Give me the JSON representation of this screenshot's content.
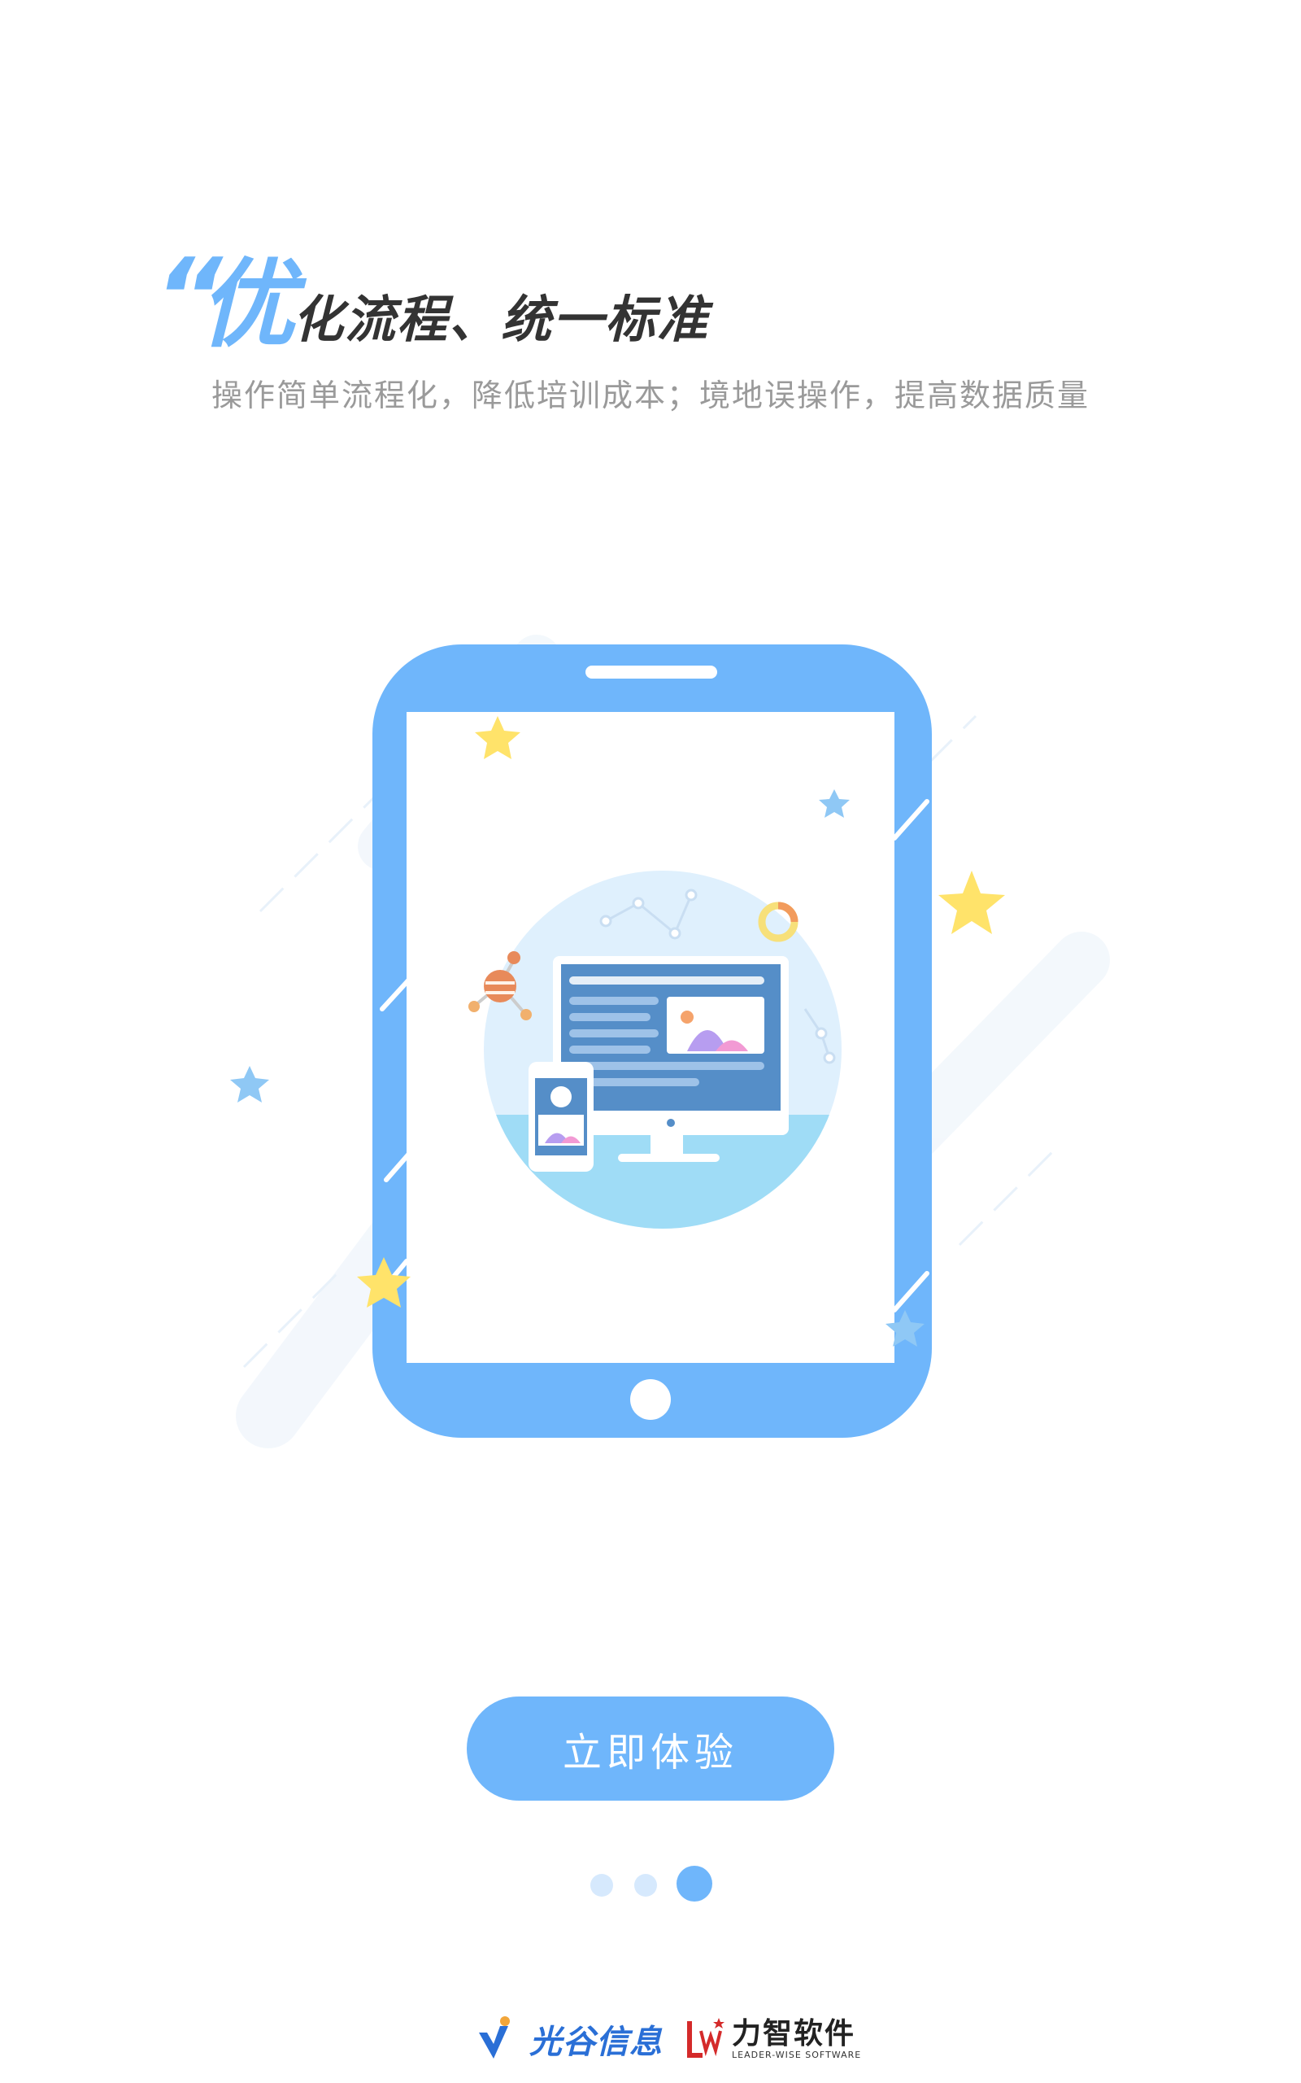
{
  "title": {
    "quote_mark": "“",
    "highlight_char": "优",
    "rest": "化流程、统一标准"
  },
  "subtitle": "操作简单流程化，降低培训成本；境地误操作，提高数据质量",
  "cta": {
    "label": "立即体验"
  },
  "pager": {
    "total": 3,
    "active": 3
  },
  "footer": {
    "logo1_name": "光谷信息",
    "logo2_name": "力智软件",
    "logo2_en": "LEADER-WISE SOFTWARE"
  },
  "colors": {
    "accent": "#6fb6fb",
    "dot_inactive": "#d6e9fd",
    "star_yellow": "#ffe36a",
    "star_blue": "#8fc8f5"
  }
}
